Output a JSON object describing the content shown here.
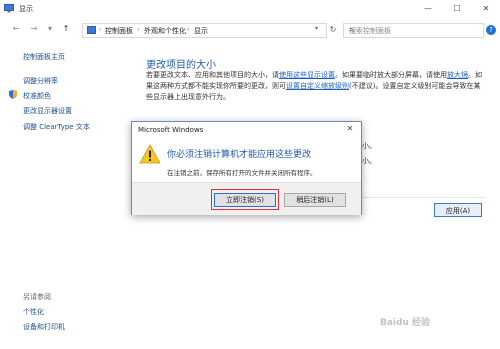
{
  "window": {
    "title": "显示"
  },
  "titlebar": {
    "min_glyph": "—",
    "max_glyph": "☐",
    "close_glyph": "✕"
  },
  "nav": {
    "back_glyph": "←",
    "forward_glyph": "→",
    "up_glyph": "↑",
    "crumbs": [
      "控制面板",
      "外观和个性化",
      "显示"
    ],
    "refresh_glyph": "↻",
    "search_placeholder": "搜索控制面板",
    "help_glyph": "?"
  },
  "sidebar": {
    "home": "控制面板主页",
    "items": [
      "调整分辨率",
      "校准颜色",
      "更改显示器设置",
      "调整 ClearType 文本"
    ],
    "see_also_title": "另请参阅",
    "see_also": [
      "个性化",
      "设备和打印机"
    ]
  },
  "main": {
    "heading": "更改项目的大小",
    "para_1": "若要更改文本、应用和其他项目的大小，请",
    "link_1": "使用这些显示设置",
    "para_2": "。如果要临时放大部分屏幕，请使用",
    "link_2": "放大镜",
    "para_3": "。如果这两种方式都不能实现你所要的更改，则可",
    "link_3": "设置自定义缩放级别",
    "para_4": "(不建议)。设置自定义级别可能会导致在某些显示器上出现意外行为。",
    "behind_1": "小。",
    "behind_2": "小。",
    "apply_label": "应用(A)"
  },
  "dialog": {
    "title": "Microsoft Windows",
    "message": "你必须注销计算机才能应用这些更改",
    "sub": "在注销之前，保存所有打开的文件并关闭所有程序。",
    "primary_label": "立即注销(S)",
    "secondary_label": "稍后注销(L)",
    "close_glyph": "✕"
  },
  "watermark": "Baidu 经验",
  "colors": {
    "accent": "#1e5bb0",
    "link": "#1a5fc4",
    "highlight": "#e0303a"
  }
}
